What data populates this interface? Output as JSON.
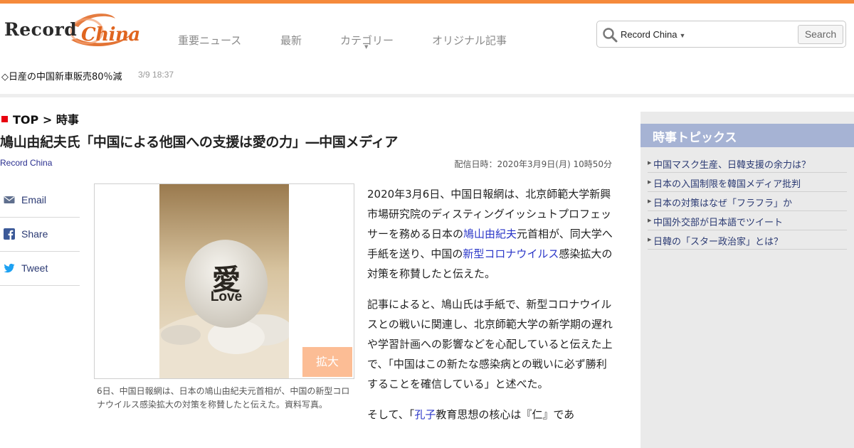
{
  "brand": {
    "name_part1": "Record",
    "name_part2": "China",
    "accent_color": "#f58a3c"
  },
  "nav": {
    "items": [
      {
        "label": "重要ニュース"
      },
      {
        "label": "最新"
      },
      {
        "label": "カテゴリー",
        "has_dropdown": true
      },
      {
        "label": "オリジナル記事"
      }
    ]
  },
  "search": {
    "scope": "Record China",
    "placeholder": "",
    "button_label": "Search",
    "icon": "search-icon"
  },
  "ticker": {
    "headline": "◇日産の中国新車販売80％減",
    "time": "3/9 18:37"
  },
  "breadcrumb": {
    "root": "TOP",
    "separator": ">",
    "current": "時事"
  },
  "article": {
    "title": "鳩山由紀夫氏「中国による他国への支援は愛の力」―中国メディア",
    "source": "Record China",
    "published": "配信日時：2020年3月9日(月) 10時50分",
    "photo": {
      "glyph": "愛",
      "word": "Love",
      "enlarge_label": "拡大",
      "caption": "6日、中国日報網は、日本の鳩山由紀夫元首相が、中国の新型コロナウイルス感染拡大の対策を称賛したと伝えた。資料写真。"
    },
    "paragraph1": {
      "t1": "2020年3月6日、中国日報網は、北京師範大学新興市場研究院のディスティングイッシュトプロフェッサーを務める日本の",
      "link1": "鳩山由紀夫",
      "t2": "元首相が、同大学へ手紙を送り、中国の",
      "link2": "新型コロナウイルス",
      "t3": "感染拡大の対策を称賛したと伝えた。"
    },
    "paragraph2": "記事によると、鳩山氏は手紙で、新型コロナウイルスとの戦いに関連し、北京師範大学の新学期の遅れや学習計画への影響などを心配していると伝えた上で、「中国はこの新たな感染病との戦いに必ず勝利することを確信している」と述べた。",
    "paragraph3": {
      "t1": "そして、「",
      "link1": "孔子",
      "t2": "教育思想の核心は『仁』であ"
    }
  },
  "share": {
    "items": [
      {
        "label": "Email",
        "icon": "mail-icon"
      },
      {
        "label": "Share",
        "icon": "facebook-icon"
      },
      {
        "label": "Tweet",
        "icon": "twitter-icon"
      }
    ]
  },
  "sidebar": {
    "title": "時事トピックス",
    "topics": [
      {
        "label": "中国マスク生産、日韓支援の余力は？"
      },
      {
        "label": "日本の入国制限を韓国メディア批判"
      },
      {
        "label": "日本の対策はなぜ「フラフラ」か"
      },
      {
        "label": "中国外交部が日本語でツイート"
      },
      {
        "label": "日韓の「スター政治家」とは？"
      }
    ]
  }
}
